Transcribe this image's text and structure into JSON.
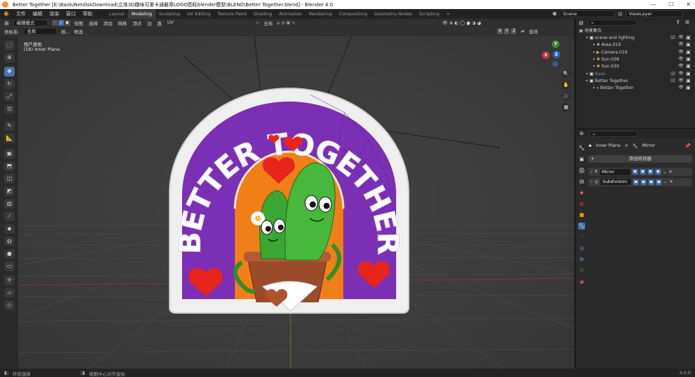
{
  "window": {
    "title": "Better Together [E:\\BaiduNetdiskDownload\\立体3D趣味可爱卡通截章LOGO图标blender模型\\BLEND\\Better Together.blend] - Blender 4.0",
    "min": "—",
    "max": "☐",
    "close": "✕"
  },
  "menu": [
    "文件",
    "编辑",
    "渲染",
    "窗口",
    "帮助"
  ],
  "workspaces": [
    "Layout",
    "Modeling",
    "Sculpting",
    "UV Editing",
    "Texture Paint",
    "Shading",
    "Animation",
    "Rendering",
    "Compositing",
    "Geometry Nodes",
    "Scripting"
  ],
  "workspace_add": "+",
  "scene_name": "Scene",
  "view_layer": "ViewLayer",
  "header": {
    "mode": "编辑模式",
    "menus": [
      "视图",
      "选择",
      "添加",
      "网格",
      "顶点",
      "边",
      "面",
      "UV"
    ],
    "orientation_label": "坐标系:",
    "orientation": "全局",
    "drag_label": "拖...",
    "drag_value": "框选",
    "pivot": "全局",
    "axes": [
      "X",
      "Y",
      "Z"
    ],
    "options": "选项"
  },
  "viewport": {
    "view_name": "用户透视",
    "object_name": "(18) Inner Plane",
    "sticker_text": "BETTER TOGETHER",
    "nav_axes": [
      "X",
      "Y",
      "Z"
    ]
  },
  "outliner": {
    "root": "场景集合",
    "items": [
      {
        "name": "scene and lighting",
        "depth": 0,
        "icon": "collection-icon"
      },
      {
        "name": "Area.019",
        "depth": 1,
        "icon": "light-icon"
      },
      {
        "name": "Camera.019",
        "depth": 1,
        "icon": "camera-icon"
      },
      {
        "name": "Sun.038",
        "depth": 1,
        "icon": "light-icon"
      },
      {
        "name": "Sun.039",
        "depth": 1,
        "icon": "light-icon"
      },
      {
        "name": "Base",
        "depth": 0,
        "icon": "collection-icon"
      },
      {
        "name": "Better Together",
        "depth": 0,
        "icon": "collection-icon"
      },
      {
        "name": "Better Together",
        "depth": 1,
        "icon": "armature-icon"
      }
    ]
  },
  "properties": {
    "breadcrumb_object": "Inner Plane",
    "breadcrumb_sep": ">",
    "breadcrumb_modifier": "Mirror",
    "add_modifier": "添加修改器",
    "modifiers": [
      {
        "name": "Mirror",
        "icon": "mirror-icon"
      },
      {
        "name": "Subdivision",
        "icon": "subdivision-icon"
      }
    ]
  },
  "status": {
    "left": "环状选择",
    "mid": "视图中心对齐鼠标",
    "version": "4.0.0"
  },
  "colors": {
    "accent": "#4772b3",
    "sticker_purple": "#7b2fb5",
    "sticker_orange": "#f07f18",
    "cactus": "#3aa832"
  }
}
